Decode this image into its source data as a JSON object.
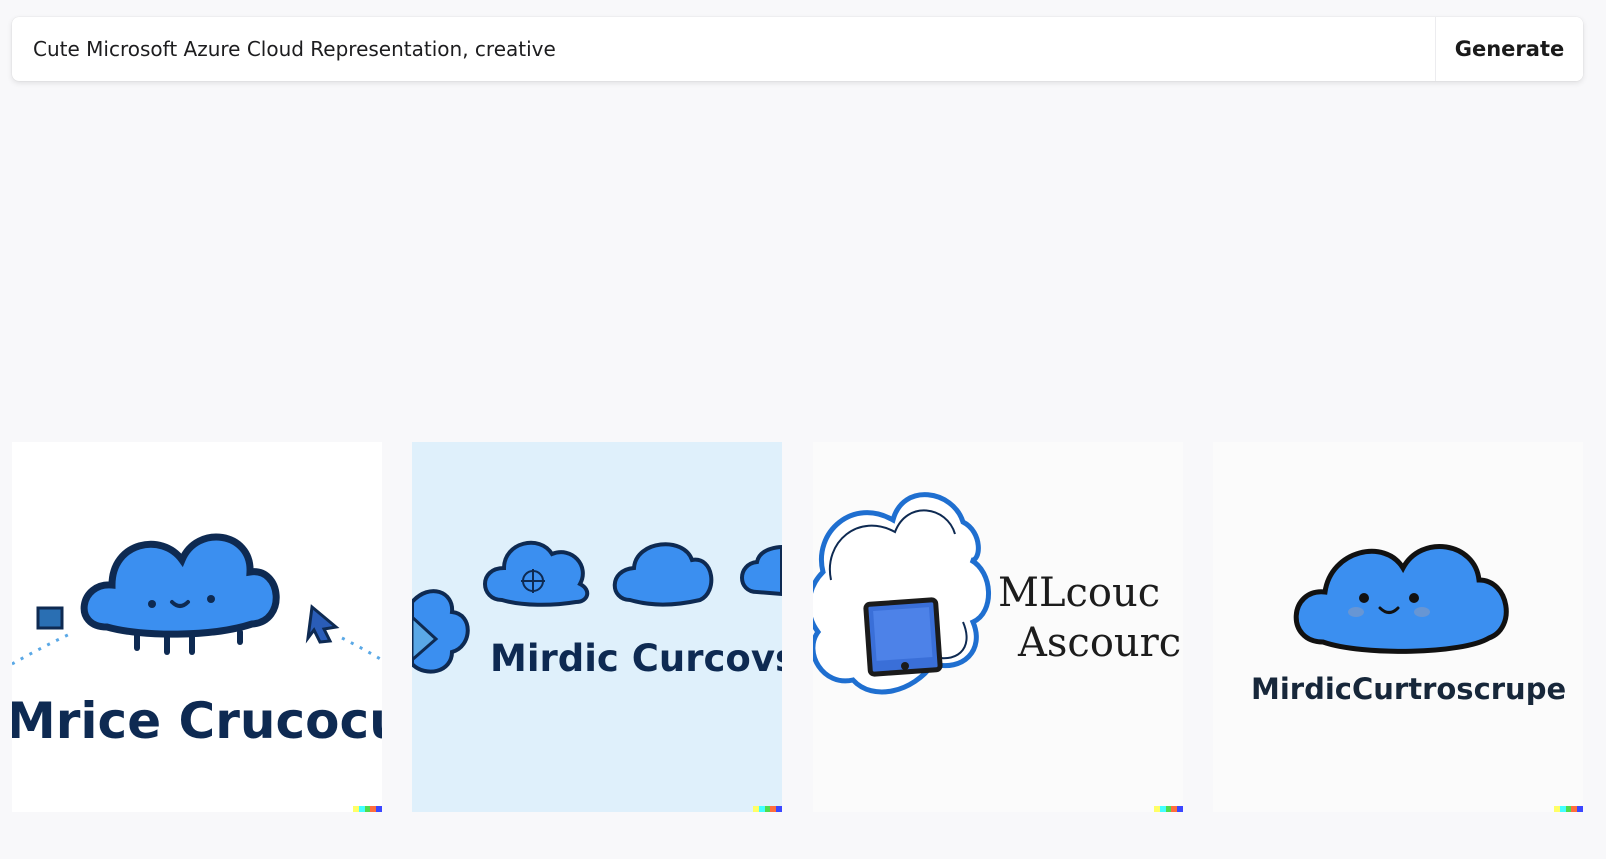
{
  "prompt": {
    "value": "Cute Microsoft Azure Cloud Representation, creative",
    "generate_label": "Generate"
  },
  "results": [
    {
      "caption": "Mrice Crucocubi",
      "background": "#ffffff"
    },
    {
      "caption": "Mirdic Curcovsi",
      "background": "#dff0fb"
    },
    {
      "caption_line1": "MLcouc",
      "caption_line2": "Ascourc",
      "background": "#fbfbfb"
    },
    {
      "caption": "MirdicCurtroscrupe",
      "background": "#fbfbfb"
    }
  ],
  "colors": {
    "cloud_blue": "#3b8ff0",
    "outline": "#0e2a52",
    "watermark": [
      "#ffff66",
      "#42ffff",
      "#51da4c",
      "#ff6e3c",
      "#3c46ff"
    ]
  }
}
